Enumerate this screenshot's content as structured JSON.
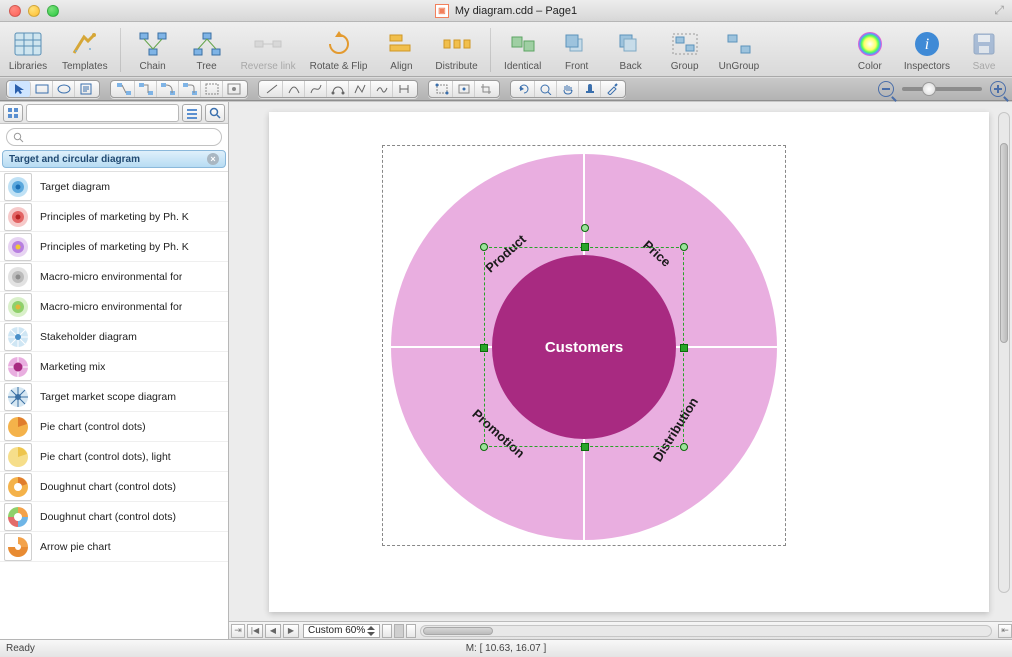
{
  "window": {
    "title": "My diagram.cdd – Page1"
  },
  "toolbar": {
    "libraries": "Libraries",
    "templates": "Templates",
    "chain": "Chain",
    "tree": "Tree",
    "reverse_link": "Reverse link",
    "rotate_flip": "Rotate & Flip",
    "align": "Align",
    "distribute": "Distribute",
    "identical": "Identical",
    "front": "Front",
    "back": "Back",
    "group": "Group",
    "ungroup": "UnGroup",
    "color": "Color",
    "inspectors": "Inspectors",
    "save": "Save"
  },
  "sidebar": {
    "header": "Target and circular diagram",
    "search_placeholder": "",
    "items": [
      {
        "label": "Target diagram",
        "thumb": "target-blue"
      },
      {
        "label": "Principles of marketing by Ph. K",
        "thumb": "target-red"
      },
      {
        "label": "Principles of marketing by Ph. K",
        "thumb": "target-purple"
      },
      {
        "label": "Macro-micro environmental for",
        "thumb": "target-gray"
      },
      {
        "label": "Macro-micro environmental for",
        "thumb": "target-green"
      },
      {
        "label": "Stakeholder diagram",
        "thumb": "segmented-blue"
      },
      {
        "label": "Marketing mix",
        "thumb": "marketing-mix"
      },
      {
        "label": "Target market scope diagram",
        "thumb": "scope-blue"
      },
      {
        "label": "Pie chart (control dots)",
        "thumb": "pie-orange"
      },
      {
        "label": "Pie chart (control dots), light",
        "thumb": "pie-yellow"
      },
      {
        "label": "Doughnut chart (control dots)",
        "thumb": "donut-orange"
      },
      {
        "label": "Doughnut chart (control dots)",
        "thumb": "donut-multi"
      },
      {
        "label": "Arrow pie chart",
        "thumb": "arrow-pie"
      }
    ]
  },
  "canvas": {
    "zoom_label": "Custom 60%"
  },
  "status": {
    "left": "Ready",
    "center": "M: [ 10.63, 16.07 ]"
  },
  "chart_data": {
    "type": "pie",
    "title": "",
    "center_label": "Customers",
    "categories": [
      "Product",
      "Price",
      "Distribution",
      "Promotion"
    ],
    "values": [
      1,
      1,
      1,
      1
    ],
    "colors": {
      "outer_ring": "#e9aee0",
      "inner_circle": "#a82a81",
      "dividers": "#ffffff"
    },
    "description": "Marketing mix diagram: four equal outer segments labelled Product, Price, Distribution, Promotion around a central 'Customers' circle. Inner circle is the currently selected object."
  }
}
